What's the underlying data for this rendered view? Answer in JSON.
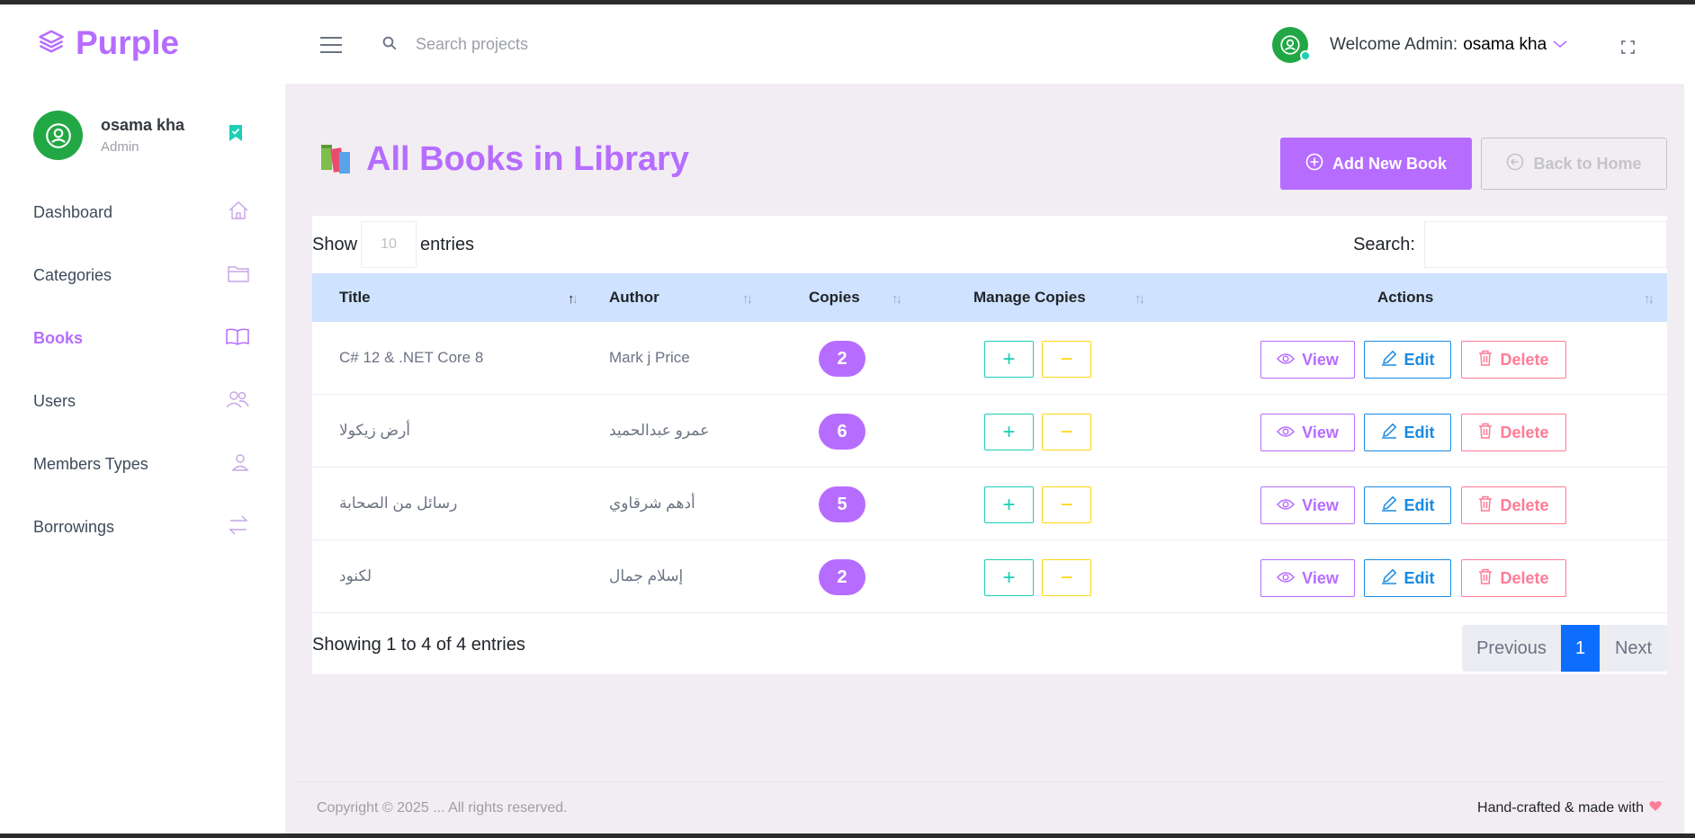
{
  "brand": {
    "name": "Purple"
  },
  "navbar": {
    "search_placeholder": "Search projects",
    "welcome_prefix": "Welcome Admin: ",
    "welcome_user": "osama kha"
  },
  "sidebar": {
    "profile": {
      "name": "osama kha",
      "role": "Admin"
    },
    "items": [
      {
        "label": "Dashboard",
        "icon": "home-icon"
      },
      {
        "label": "Categories",
        "icon": "folder-icon"
      },
      {
        "label": "Books",
        "icon": "book-open-icon",
        "active": true
      },
      {
        "label": "Users",
        "icon": "users-icon"
      },
      {
        "label": "Members Types",
        "icon": "user-icon"
      },
      {
        "label": "Borrowings",
        "icon": "swap-icon"
      }
    ]
  },
  "page": {
    "title": "All Books in Library",
    "add_button": "Add New Book",
    "back_button": "Back to Home"
  },
  "table_controls": {
    "show_label": "Show",
    "length_value": "10",
    "entries_label": "entries",
    "search_label": "Search:"
  },
  "table": {
    "columns": [
      "Title",
      "Author",
      "Copies",
      "Manage Copies",
      "Actions"
    ],
    "rows": [
      {
        "title": "C# 12 & .NET Core 8",
        "author": "Mark j Price",
        "copies": "2"
      },
      {
        "title": "أرض زيكولا",
        "author": "عمرو عبدالحميد",
        "copies": "6"
      },
      {
        "title": "رسائل من الصحابة",
        "author": "أدهم شرقاوي",
        "copies": "5"
      },
      {
        "title": "لكنود",
        "author": "إسلام جمال",
        "copies": "2"
      }
    ],
    "action_labels": {
      "view": "View",
      "edit": "Edit",
      "delete": "Delete"
    }
  },
  "table_footer": {
    "info": "Showing 1 to 4 of 4 entries",
    "previous": "Previous",
    "current_page": "1",
    "next": "Next"
  },
  "footer": {
    "copyright": "Copyright © 2025 ... All rights reserved.",
    "made_with": "Hand-crafted & made with"
  },
  "colors": {
    "primary": "#b66dff",
    "success": "#1bcfb4",
    "warning": "#fed713",
    "info": "#198ae3",
    "danger": "#fe7c96",
    "table_header": "#cfe2ff"
  }
}
